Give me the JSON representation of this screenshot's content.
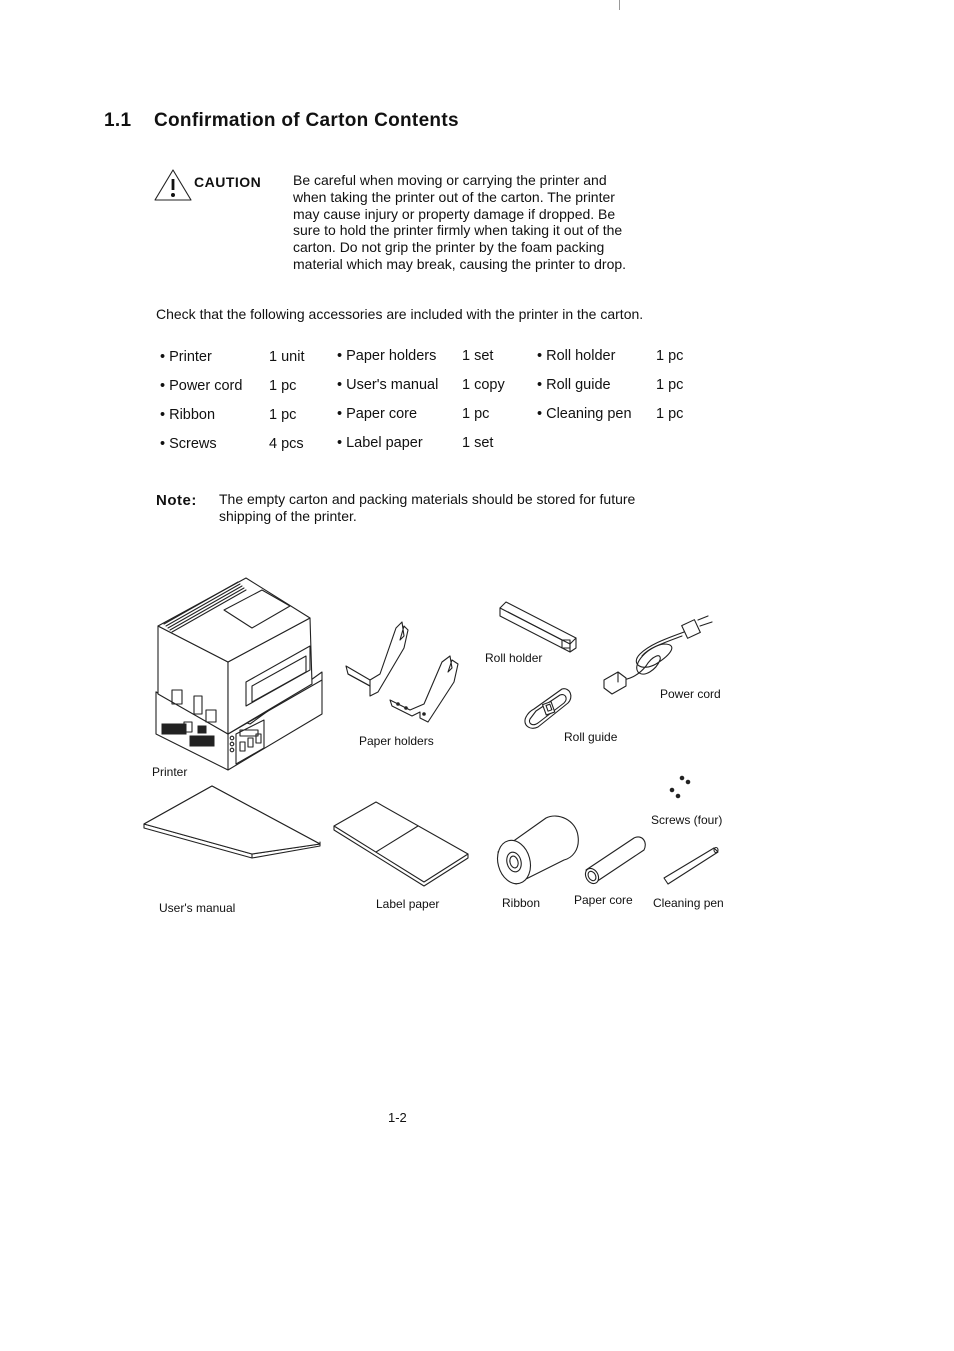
{
  "section": {
    "number": "1.1",
    "title": "Confirmation of Carton Contents"
  },
  "caution": {
    "icon": "warning-triangle-icon",
    "label": "CAUTION",
    "lines": [
      "Be careful when moving or carrying the printer and",
      "when taking the printer out of the carton.  The printer",
      "may cause injury or property damage if dropped.  Be",
      "sure to hold the printer firmly when taking it out of the",
      "carton.  Do not grip the printer by the foam packing",
      "material which may break, causing the printer to drop."
    ]
  },
  "intro": "Check that the following accessories are included with the printer in the carton.",
  "accessories": [
    {
      "name": "• Printer",
      "qty": "1 unit"
    },
    {
      "name": "• Power cord",
      "qty": "1 pc"
    },
    {
      "name": "• Ribbon",
      "qty": "1 pc"
    },
    {
      "name": "• Screws",
      "qty": "4 pcs"
    },
    {
      "name": "• Paper holders",
      "qty": "1 set"
    },
    {
      "name": "• User's manual",
      "qty": "1 copy"
    },
    {
      "name": "• Paper core",
      "qty": "1 pc"
    },
    {
      "name": "• Label paper",
      "qty": "1 set"
    },
    {
      "name": "• Roll holder",
      "qty": "1 pc"
    },
    {
      "name": "• Roll guide",
      "qty": "1 pc"
    },
    {
      "name": "• Cleaning pen",
      "qty": "1 pc"
    }
  ],
  "note": {
    "label": "Note:",
    "lines": [
      "The empty carton and packing materials should be stored for future",
      "shipping of the printer."
    ]
  },
  "figure": {
    "captions": {
      "printer": "Printer",
      "paper_holders": "Paper holders",
      "roll_holder": "Roll holder",
      "power_cord": "Power cord",
      "roll_guide": "Roll guide",
      "screws": "Screws (four)",
      "users_manual": "User's manual",
      "label_paper": "Label paper",
      "ribbon": "Ribbon",
      "paper_core": "Paper core",
      "cleaning_pen": "Cleaning pen"
    }
  },
  "page_number": "1-2"
}
